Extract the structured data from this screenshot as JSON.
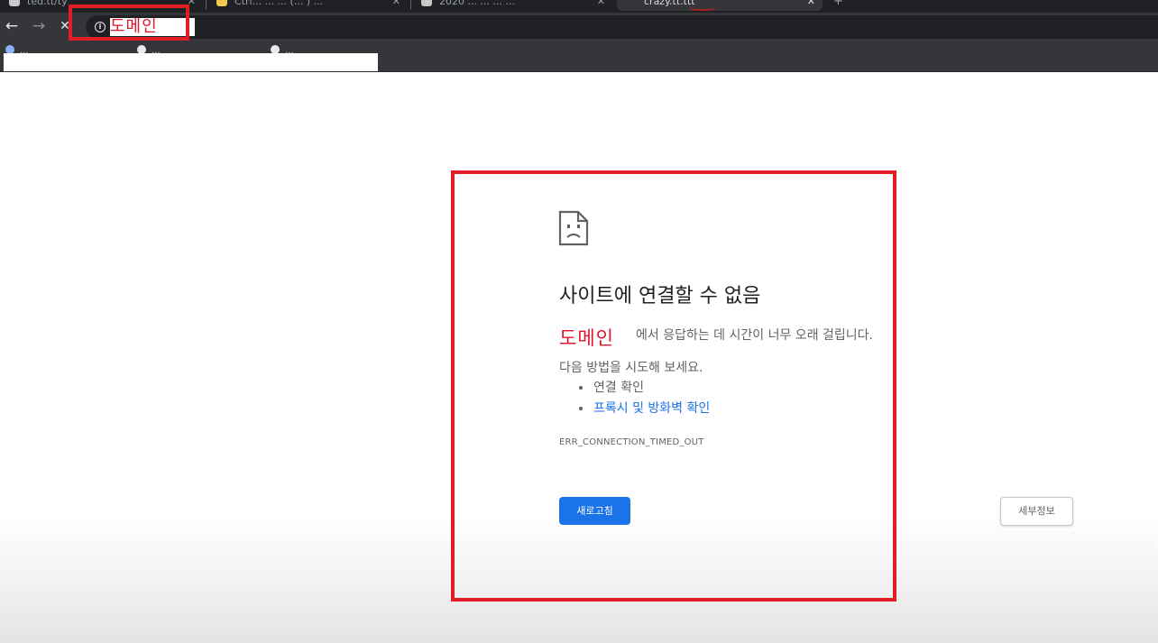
{
  "tabs": [
    {
      "label": "ted.tt/ty",
      "favicon": "page-icon"
    },
    {
      "label": "Ctrl... ... ... (... ) ...",
      "favicon": "yellow-icon"
    },
    {
      "label": "2020 ... ... ... ...",
      "favicon": "page-icon"
    },
    {
      "label": "crazy.tt.ttt",
      "favicon": "none",
      "active": true
    }
  ],
  "toolbar": {
    "back_icon": "←",
    "forward_icon": "→",
    "stop_icon": "✕",
    "info_icon": "i",
    "address_text": "도메인"
  },
  "bookmarks": [
    {
      "label": "...",
      "icon": "globe-icon"
    },
    {
      "label": "...",
      "icon": "page-icon"
    },
    {
      "label": "...",
      "icon": "page-icon"
    }
  ],
  "error_page": {
    "title": "사이트에 연결할 수 없음",
    "domain_label": "도메인",
    "description": "에서 응답하는 데 시간이 너무 오래 걸립니다.",
    "try_text": "다음 방법을 시도해 보세요.",
    "suggestions": [
      {
        "label": "연결 확인",
        "link": false
      },
      {
        "label": "프록시 및 방화벽 확인",
        "link": true
      }
    ],
    "error_code": "ERR_CONNECTION_TIMED_OUT",
    "reload_label": "새로고침",
    "details_label": "세부정보"
  },
  "colors": {
    "annotation_red": "#e31d25",
    "primary_blue": "#1a73e8",
    "chrome_dark": "#35363a"
  }
}
